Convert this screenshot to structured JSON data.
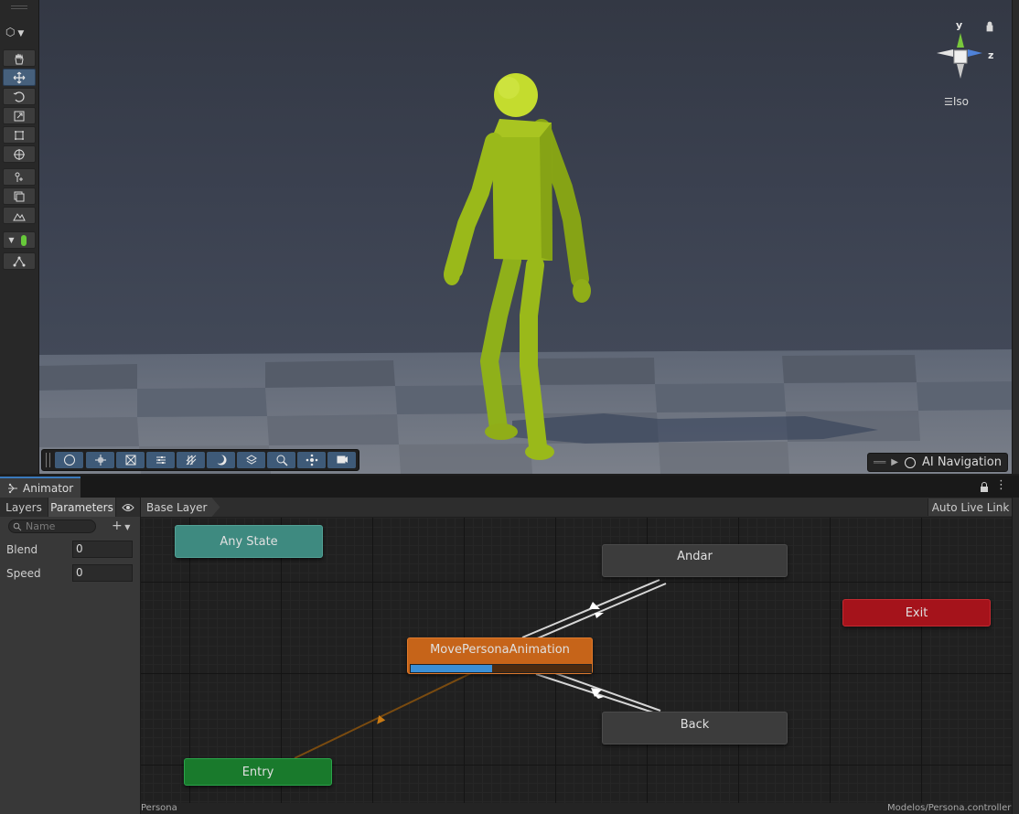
{
  "scene": {
    "gizmo": {
      "y_label": "y",
      "z_label": "z",
      "projection": "Iso"
    },
    "ai_navigation_label": "AI Navigation",
    "colors": {
      "character": "#9ab91a",
      "wall": "#3a3f4b",
      "floor": "#6e7480"
    }
  },
  "animator": {
    "tab_label": "Animator",
    "params_tabs": [
      "Layers",
      "Parameters"
    ],
    "search_placeholder": "Name",
    "parameters": [
      {
        "name": "Blend",
        "value": "0"
      },
      {
        "name": "Speed",
        "value": "0"
      }
    ],
    "breadcrumb": "Base Layer",
    "auto_live_link": "Auto Live Link",
    "states": {
      "any_state": "Any State",
      "entry": "Entry",
      "exit": "Exit",
      "current": "MovePersonaAnimation",
      "andar": "Andar",
      "back": "Back"
    },
    "current_progress": 0.45,
    "colors": {
      "any_state": "#3e8a80",
      "entry": "#197a2c",
      "exit": "#a5131b",
      "current": "#c66419",
      "default_state": "#3c3c3c",
      "progress": "#3a8fd6"
    },
    "status_left": "Persona",
    "status_right": "Modelos/Persona.controller"
  }
}
